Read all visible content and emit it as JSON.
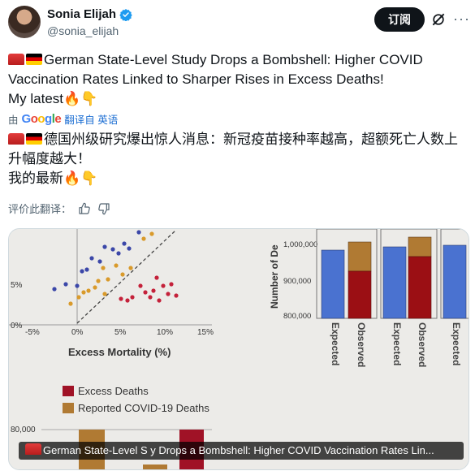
{
  "header": {
    "name": "Sonia Elijah",
    "handle": "@sonia_elijah",
    "subscribe_label": "订阅",
    "more_label": "···"
  },
  "post": {
    "title_line1": "German State-Level Study Drops a Bombshell: Higher COVID",
    "title_line2": "Vaccination Rates Linked to Sharper Rises in Excess Deaths!",
    "latest_line": "My latest",
    "translated_by": "由",
    "google_letters": [
      "G",
      "o",
      "o",
      "g",
      "l",
      "e"
    ],
    "translate_link": "翻译自 英语",
    "cn_line1": "德国州级研究爆出惊人消息：新冠疫苗接种率越高，超额死亡人数上",
    "cn_line2": "升幅度越大！",
    "cn_latest": "我的最新",
    "rate_label": "评价此翻译："
  },
  "chart_left": {
    "x_label": "Excess Mortality (%)",
    "x_ticks": [
      "-5%",
      "0%",
      "5%",
      "10%",
      "15%"
    ],
    "y_ticks": [
      "5%",
      "0%"
    ],
    "legend": [
      "Excess Deaths",
      "Reported COVID-19 Deaths"
    ],
    "bottom_tick": "80,000",
    "colors": {
      "blue": "#3b47a8",
      "orange": "#d99a2b",
      "red": "#c4213a",
      "excess": "#a01226",
      "reported": "#b07a33"
    }
  },
  "chart_right": {
    "y_label": "Number of De",
    "y_ticks": [
      "1,000,000",
      "900,000",
      "800,000"
    ],
    "x_labels": [
      "Expected",
      "Observed",
      "Expected",
      "Observed",
      "Expected"
    ],
    "colors": {
      "expected": "#4a72d0",
      "observed_red": "#9b0f14",
      "observed_tan": "#b07a33"
    }
  },
  "caption": "German State-Level S     y Drops a Bombshell: Higher COVID Vaccination Rates Lin..."
}
